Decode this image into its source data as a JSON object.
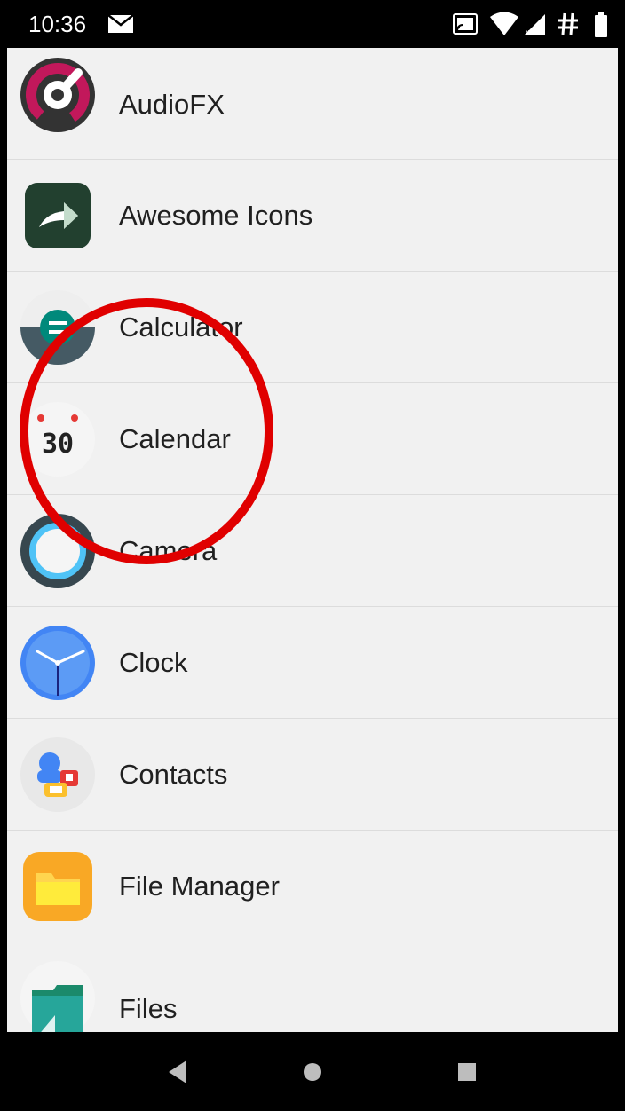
{
  "status_bar": {
    "time": "10:36",
    "icons": [
      "email-icon",
      "cast-icon",
      "wifi-icon",
      "signal-icon",
      "hash-icon",
      "battery-icon"
    ]
  },
  "apps": [
    {
      "label": "AudioFX",
      "icon": "audiofx-icon"
    },
    {
      "label": "Awesome Icons",
      "icon": "awesome-icons-icon"
    },
    {
      "label": "Calculator",
      "icon": "calculator-icon"
    },
    {
      "label": "Calendar",
      "icon": "calendar-icon",
      "icon_text": "30"
    },
    {
      "label": "Camera",
      "icon": "camera-icon"
    },
    {
      "label": "Clock",
      "icon": "clock-icon"
    },
    {
      "label": "Contacts",
      "icon": "contacts-icon"
    },
    {
      "label": "File Manager",
      "icon": "file-manager-icon"
    },
    {
      "label": "Files",
      "icon": "files-icon"
    }
  ],
  "nav_bar": {
    "buttons": [
      "back-icon",
      "home-icon",
      "recents-icon"
    ]
  },
  "annotation": {
    "shape": "circle",
    "color": "#e00000",
    "highlighted_item": "Calendar"
  },
  "colors": {
    "status_bar_bg": "#000000",
    "list_bg": "#f1f1f1",
    "annotation_red": "#e00000"
  }
}
